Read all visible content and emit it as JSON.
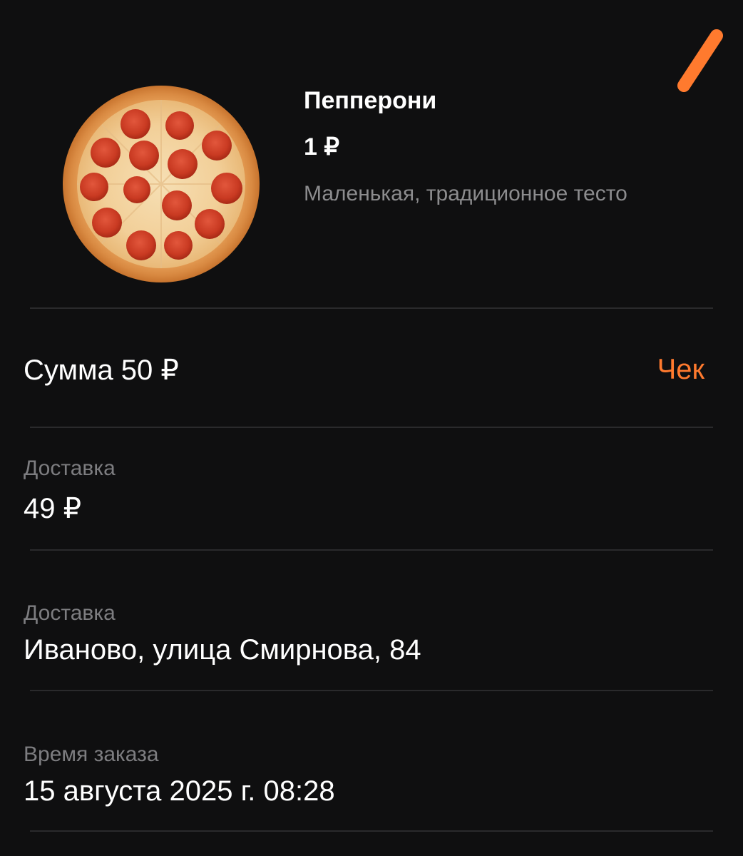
{
  "colors": {
    "background": "#0f0f10",
    "accent": "#ff7a2e",
    "muted_text": "#7d7d80",
    "divider": "#2a2a2c"
  },
  "order_item": {
    "image_icon": "pepperoni-pizza-image",
    "name": "Пепперони",
    "price": "1 ₽",
    "description": "Маленькая, традиционное тесто"
  },
  "summary": {
    "sum_label": "Сумма 50 ₽",
    "receipt_link": "Чек"
  },
  "delivery_cost": {
    "label": "Доставка",
    "value": "49 ₽"
  },
  "delivery_address": {
    "label": "Доставка",
    "value": "Иваново, улица Смирнова, 84"
  },
  "order_time": {
    "label": "Время заказа",
    "value": "15 августа 2025 г. 08:28"
  }
}
